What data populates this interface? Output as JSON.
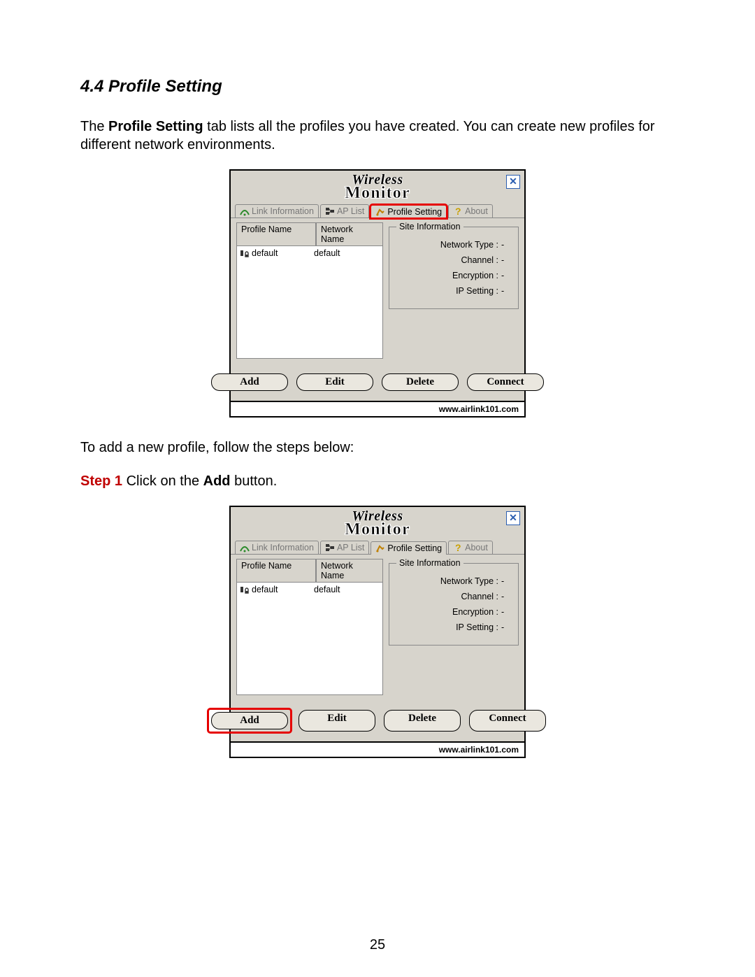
{
  "section": {
    "number": "4.4",
    "title": "Profile Setting"
  },
  "para1_pre": "The ",
  "para1_bold": "Profile Setting",
  "para1_post": " tab lists all the profiles you have created. You can create new profiles for different network environments.",
  "para2": "To add a new profile, follow the steps below:",
  "step1": {
    "label": "Step 1",
    "pre": " Click on the ",
    "bold": "Add",
    "post": " button."
  },
  "app": {
    "title_line1": "Wireless",
    "title_line2": "Monitor",
    "close_glyph": "✕",
    "footer": "www.airlink101.com",
    "tabs": {
      "link_info": "Link Information",
      "ap_list": "AP List",
      "profile_setting": "Profile Setting",
      "about": "About"
    },
    "columns": {
      "profile_name": "Profile Name",
      "network_name": "Network Name"
    },
    "rows": [
      {
        "profile": "default",
        "network": "default"
      }
    ],
    "site_info": {
      "legend": "Site Information",
      "network_type": {
        "label": "Network Type :",
        "value": "-"
      },
      "channel": {
        "label": "Channel :",
        "value": "-"
      },
      "encryption": {
        "label": "Encryption :",
        "value": "-"
      },
      "ip_setting": {
        "label": "IP Setting :",
        "value": "-"
      }
    },
    "buttons": {
      "add": "Add",
      "edit": "Edit",
      "delete": "Delete",
      "connect": "Connect"
    }
  },
  "page_number": "25"
}
